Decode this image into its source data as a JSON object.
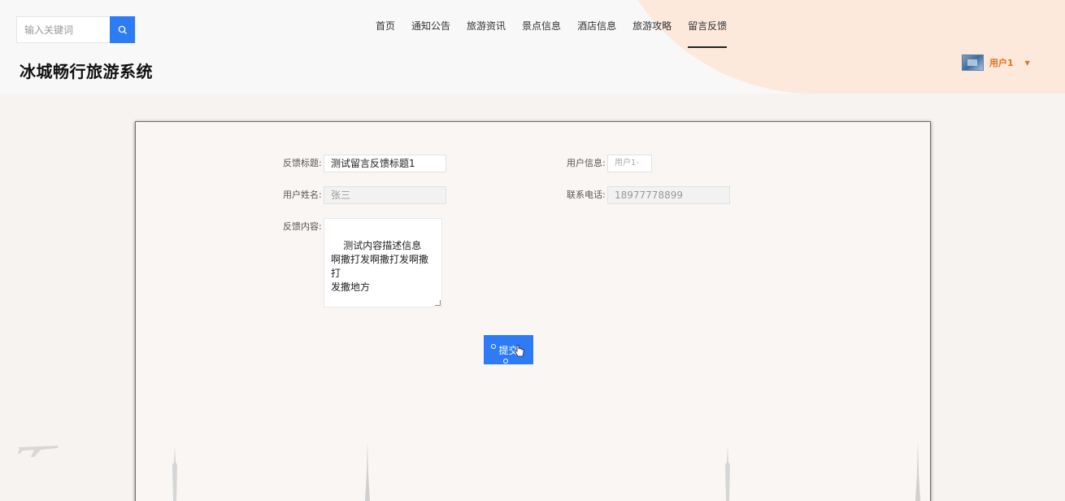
{
  "search": {
    "placeholder": "输入关键词"
  },
  "nav": {
    "items": [
      {
        "label": "首页"
      },
      {
        "label": "通知公告"
      },
      {
        "label": "旅游资讯"
      },
      {
        "label": "景点信息"
      },
      {
        "label": "酒店信息"
      },
      {
        "label": "旅游攻略"
      },
      {
        "label": "留言反馈"
      }
    ],
    "active_index": 6
  },
  "site": {
    "title": "冰城畅行旅游系统"
  },
  "user": {
    "name": "用户1"
  },
  "form": {
    "title_label": "反馈标题:",
    "title_value": "测试留言反馈标题1",
    "userinfo_label": "用户信息:",
    "userinfo_value": "用户1-",
    "username_label": "用户姓名:",
    "username_value": "张三",
    "phone_label": "联系电话:",
    "phone_value": "18977778899",
    "content_label": "反馈内容:",
    "content_value": "测试内容描述信息\n啊撒打发啊撒打发啊撒打\n发撒地方",
    "submit_label": "提交"
  },
  "colors": {
    "accent": "#2d7cf6",
    "user": "#e8721c"
  }
}
